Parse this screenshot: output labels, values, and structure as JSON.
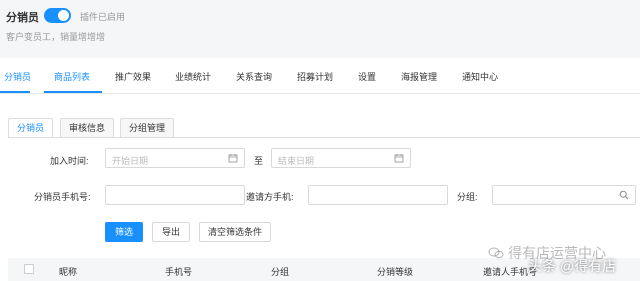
{
  "header": {
    "title": "分销员",
    "status": "插件已启用",
    "subtitle": "客户变员工，销量增增增"
  },
  "nav": {
    "items": [
      "分销员",
      "商品列表",
      "推广效果",
      "业绩统计",
      "关系查询",
      "招募计划",
      "设置",
      "海报管理",
      "通知中心"
    ]
  },
  "tabs": [
    "分销员",
    "审核信息",
    "分组管理"
  ],
  "filters": {
    "join_time_label": "加入时间:",
    "start_placeholder": "开始日期",
    "to_label": "至",
    "end_placeholder": "结束日期",
    "phone_label": "分销员手机号:",
    "inviter_label": "邀请方手机:",
    "group_label": "分组:"
  },
  "buttons": {
    "filter": "筛选",
    "export": "导出",
    "clear": "清空筛选条件"
  },
  "table": {
    "columns": [
      "昵称",
      "手机号",
      "分组",
      "分销等级",
      "邀请人手机号"
    ]
  },
  "watermark": {
    "line1": "得有店运营中心",
    "line2": "头条 @得有店"
  },
  "colors": {
    "accent": "#1890ff"
  }
}
